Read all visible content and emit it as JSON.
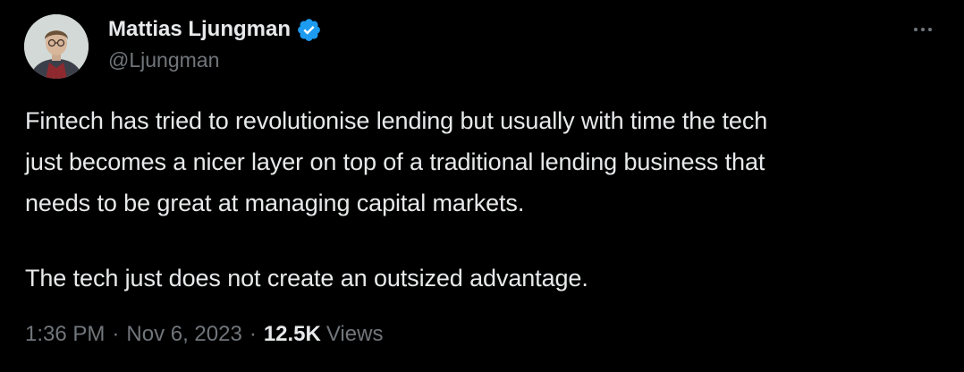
{
  "author": {
    "display_name": "Mattias Ljungman",
    "handle": "@Ljungman",
    "verified": true,
    "verified_color": "#1d9bf0",
    "avatar_icon": "avatar-photo"
  },
  "menu": {
    "icon": "more-options-icon"
  },
  "tweet": {
    "paragraphs": [
      "Fintech has tried to revolutionise lending but usually with time the tech\njust becomes a nicer layer on top of a traditional lending business that\nneeds to be great at managing capital markets.",
      "The tech just does not create an outsized advantage."
    ]
  },
  "meta": {
    "time": "1:36 PM",
    "separator": "·",
    "date": "Nov 6, 2023",
    "views_count": "12.5K",
    "views_label": "Views"
  },
  "colors": {
    "background": "#000000",
    "primary_text": "#e7e9ea",
    "secondary_text": "#71767b"
  }
}
